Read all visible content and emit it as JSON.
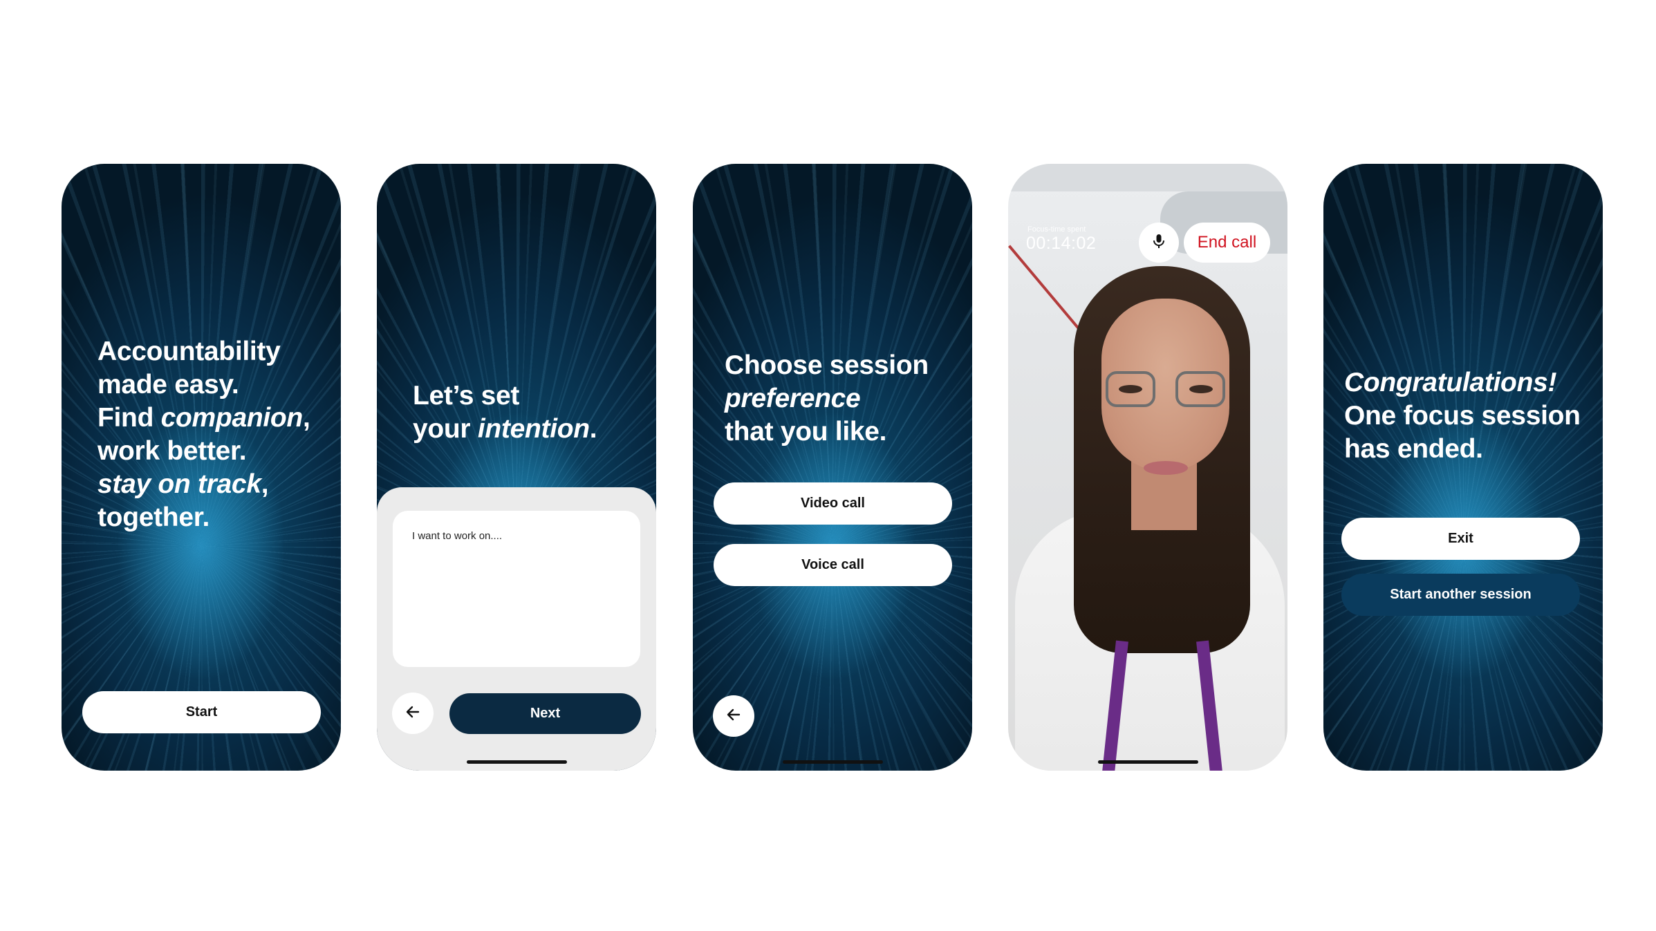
{
  "screens": {
    "onboarding": {
      "headline_lines": [
        {
          "parts": [
            {
              "text": "Accountability",
              "italic": false
            }
          ]
        },
        {
          "parts": [
            {
              "text": "made easy.",
              "italic": false
            }
          ]
        },
        {
          "parts": [
            {
              "text": "Find ",
              "italic": false
            },
            {
              "text": "companion",
              "italic": true
            },
            {
              "text": ",",
              "italic": false
            }
          ]
        },
        {
          "parts": [
            {
              "text": "work better.",
              "italic": false
            }
          ]
        },
        {
          "parts": [
            {
              "text": "stay on track",
              "italic": true
            },
            {
              "text": ",",
              "italic": false
            }
          ]
        },
        {
          "parts": [
            {
              "text": "together.",
              "italic": false
            }
          ]
        }
      ],
      "start_label": "Start"
    },
    "intention": {
      "headline_lines": [
        {
          "parts": [
            {
              "text": "Let’s set",
              "italic": false
            }
          ]
        },
        {
          "parts": [
            {
              "text": "your ",
              "italic": false
            },
            {
              "text": "intention",
              "italic": true
            },
            {
              "text": ".",
              "italic": false
            }
          ]
        }
      ],
      "textbox_text": "I want to work on....",
      "back_icon": "arrow-left-icon",
      "next_label": "Next"
    },
    "preference": {
      "headline_lines": [
        {
          "parts": [
            {
              "text": "Choose session",
              "italic": false
            }
          ]
        },
        {
          "parts": [
            {
              "text": "preference",
              "italic": true
            }
          ]
        },
        {
          "parts": [
            {
              "text": "that you like.",
              "italic": false
            }
          ]
        }
      ],
      "video_call_label": "Video call",
      "voice_call_label": "Voice call",
      "back_icon": "arrow-left-icon"
    },
    "call": {
      "timer_label": "Focus-time spent",
      "timer_value": "00:14:02",
      "mic_icon": "microphone-icon",
      "end_call_label": "End call"
    },
    "complete": {
      "headline_lines": [
        {
          "parts": [
            {
              "text": "Congratulations!",
              "italic": true
            }
          ]
        },
        {
          "parts": [
            {
              "text": "One focus session",
              "italic": false
            }
          ]
        },
        {
          "parts": [
            {
              "text": "has ended.",
              "italic": false
            }
          ]
        }
      ],
      "exit_label": "Exit",
      "start_another_label": "Start another session"
    }
  },
  "colors": {
    "navy_button": "#0b2a42",
    "blue_button": "#0a3b5d",
    "end_call_red": "#d0121f",
    "sheet_gray": "#ebebeb"
  }
}
